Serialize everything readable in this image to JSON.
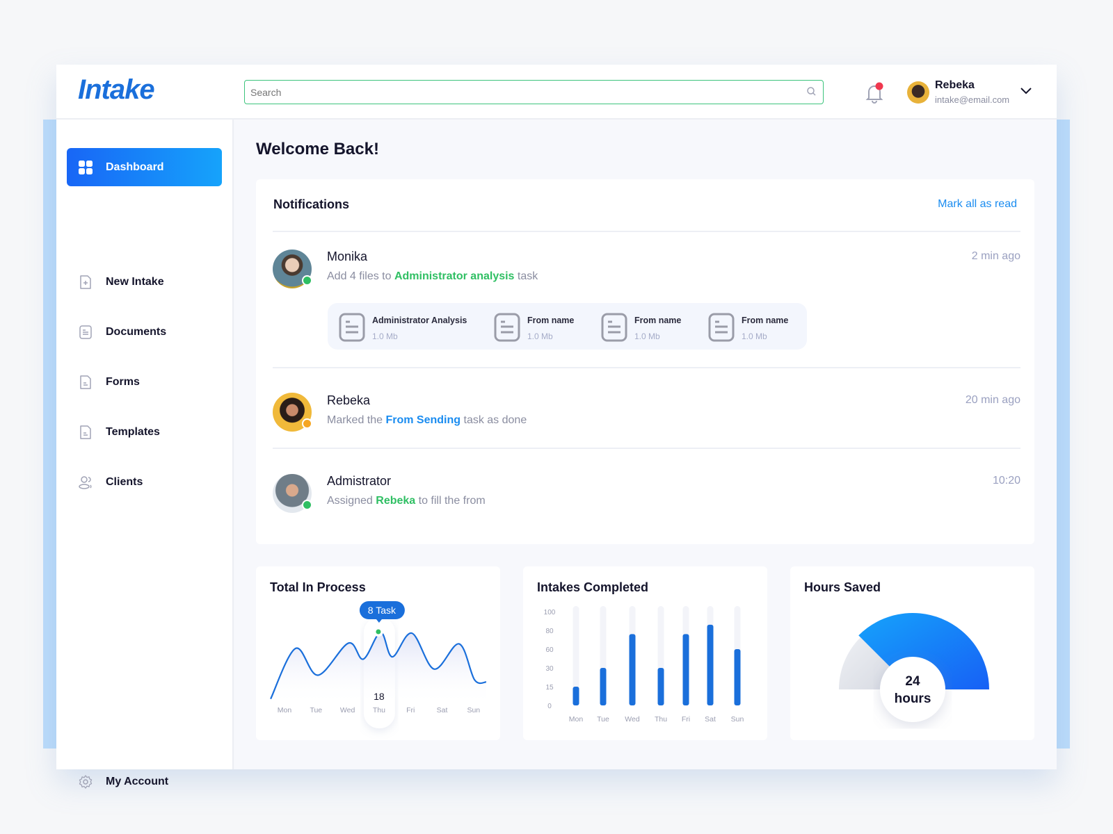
{
  "app": {
    "logo": "Intake"
  },
  "header": {
    "search_placeholder": "Search",
    "user": {
      "name": "Rebeka",
      "email": "intake@email.com"
    },
    "notification_badge_color": "#f0384f"
  },
  "sidebar": {
    "items": [
      {
        "label": "Dashboard",
        "icon": "grid-icon",
        "active": true
      },
      {
        "label": "New Intake",
        "icon": "file-plus-icon"
      },
      {
        "label": "Documents",
        "icon": "document-icon"
      },
      {
        "label": "Forms",
        "icon": "form-icon"
      },
      {
        "label": "Templates",
        "icon": "template-icon"
      },
      {
        "label": "Clients",
        "icon": "users-icon"
      }
    ],
    "account": {
      "label": "My Account",
      "icon": "gear-icon"
    }
  },
  "main": {
    "welcome": "Welcome Back!",
    "notifications": {
      "title": "Notifications",
      "mark_all": "Mark all as read",
      "items": [
        {
          "name": "Monika",
          "pre": "Add 4 files to ",
          "link": "Administrator analysis",
          "post": " task",
          "time": "2 min ago",
          "status": "online",
          "files": [
            {
              "name": "Administrator Analysis",
              "size": "1.0 Mb"
            },
            {
              "name": "From name",
              "size": "1.0 Mb"
            },
            {
              "name": "From name",
              "size": "1.0 Mb"
            },
            {
              "name": "From name",
              "size": "1.0 Mb"
            }
          ]
        },
        {
          "name": "Rebeka",
          "pre": "Marked the ",
          "link": "From Sending",
          "post": " task as done",
          "time": "20 min ago",
          "status": "away"
        },
        {
          "name": "Admistrator",
          "pre": "Assigned ",
          "link": "Rebeka",
          "post": " to fill the from",
          "time": "10:20",
          "status": "online"
        }
      ]
    }
  },
  "colors": {
    "primary": "#1a6fdb",
    "accent": "#1a8cf0",
    "green": "#2fbf63",
    "orange": "#f5a623"
  },
  "chart_data": [
    {
      "type": "line",
      "title": "Total In Process",
      "categories": [
        "Mon",
        "Tue",
        "Wed",
        "Thu",
        "Fri",
        "Sat",
        "Sun"
      ],
      "curve": [
        [
          -0.44,
          4
        ],
        [
          0.35,
          70
        ],
        [
          1.06,
          35
        ],
        [
          2.03,
          77
        ],
        [
          2.5,
          56
        ],
        [
          3.05,
          91
        ],
        [
          3.42,
          59
        ],
        [
          4.04,
          90
        ],
        [
          4.75,
          43
        ],
        [
          5.54,
          76
        ],
        [
          6.03,
          29
        ],
        [
          6.4,
          26
        ]
      ],
      "highlight": {
        "category": "Thu",
        "value": "18",
        "tooltip": "8 Task"
      }
    },
    {
      "type": "bar",
      "title": "Intakes Completed",
      "categories": [
        "Mon",
        "Tue",
        "Wed",
        "Thu",
        "Fri",
        "Sat",
        "Sun"
      ],
      "values": [
        15,
        30,
        76,
        30,
        76,
        86,
        60
      ],
      "yticks": [
        "0",
        "15",
        "30",
        "60",
        "80",
        "100"
      ],
      "ylim": [
        0,
        100
      ]
    },
    {
      "type": "gauge",
      "title": "Hours Saved",
      "value": "24",
      "unit": "hours",
      "fraction": 0.75
    }
  ]
}
